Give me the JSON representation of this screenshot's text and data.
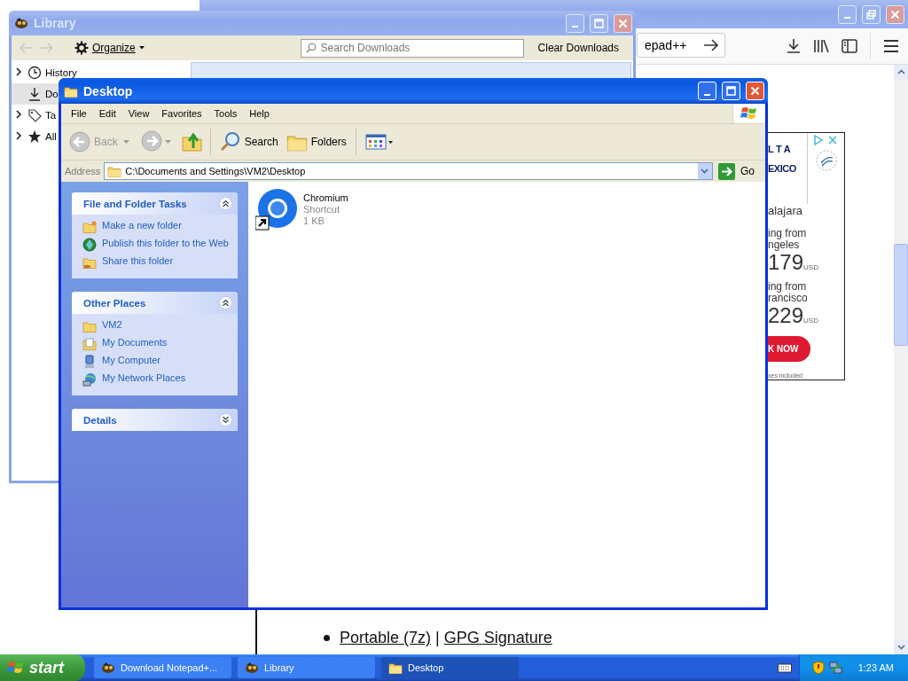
{
  "browser_window": {
    "active": false,
    "url_fragment": "epad++",
    "ad": {
      "brand_top": "LTA",
      "brand_bottom": "EXICO",
      "destination": "alajara",
      "fares": [
        {
          "line1": "ing from",
          "line2": "ngeles",
          "price": "179",
          "currency": "USD"
        },
        {
          "line1": "ing from",
          "line2": "rancisco",
          "price": "229",
          "currency": "USD"
        }
      ],
      "button": "K NOW",
      "footnote": "xes included"
    },
    "links": [
      {
        "text": "Portable (7z)"
      },
      {
        "text": "GPG Signature"
      }
    ],
    "separator": "|"
  },
  "library_window": {
    "title": "Library",
    "active": false,
    "organize": "Organize",
    "search_placeholder": "Search Downloads",
    "clear_button": "Clear Downloads",
    "places": [
      {
        "label": "History",
        "expandable": true,
        "selected": false
      },
      {
        "label": "Do",
        "expandable": false,
        "selected": true
      },
      {
        "label": "Ta",
        "expandable": true,
        "selected": false
      },
      {
        "label": "All",
        "expandable": true,
        "selected": false
      }
    ]
  },
  "explorer_window": {
    "title": "Desktop",
    "active": true,
    "menu": [
      "File",
      "Edit",
      "View",
      "Favorites",
      "Tools",
      "Help"
    ],
    "toolbar": {
      "back": {
        "label": "Back",
        "disabled": true
      },
      "forward": {
        "disabled": true
      },
      "search": "Search",
      "folders": "Folders"
    },
    "address": {
      "label": "Address",
      "value": "C:\\Documents and Settings\\VM2\\Desktop",
      "go": "Go"
    },
    "task_panes": [
      {
        "title": "File and Folder Tasks",
        "expanded": true,
        "items": [
          "Make a new folder",
          "Publish this folder to the Web",
          "Share this folder"
        ]
      },
      {
        "title": "Other Places",
        "expanded": true,
        "items": [
          "VM2",
          "My Documents",
          "My Computer",
          "My Network Places"
        ]
      },
      {
        "title": "Details",
        "expanded": false
      }
    ],
    "files": [
      {
        "name": "Chromium",
        "type": "Shortcut",
        "size": "1 KB",
        "selected": false
      }
    ]
  },
  "taskbar": {
    "start": "start",
    "buttons": [
      {
        "label": "Download Notepad+...",
        "selected": false
      },
      {
        "label": "Library",
        "selected": false
      },
      {
        "label": "Desktop",
        "selected": true
      }
    ],
    "clock": "1:23 AM"
  }
}
